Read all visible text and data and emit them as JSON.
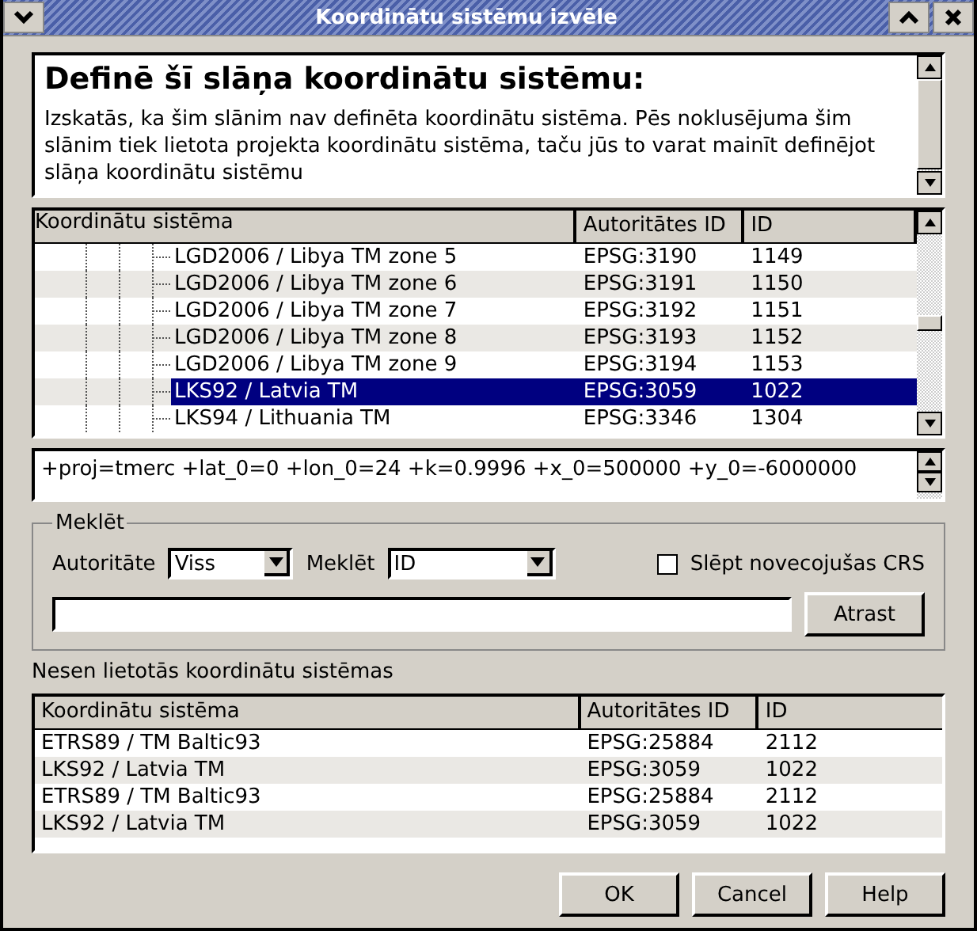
{
  "window": {
    "title": "Koordinātu sistēmu izvēle"
  },
  "description": {
    "heading": "Definē šī slāņa koordinātu sistēmu:",
    "text": "Izskatās, ka šim slānim nav definēta koordinātu sistēma. Pēs noklusējuma šim slānim tiek lietota projekta koordinātu sistēma, taču jūs to varat mainīt definējot slāņa koordinātu sistēmu"
  },
  "crs_tree": {
    "columns": [
      "Koordinātu sistēma",
      "Autoritātes ID",
      "ID"
    ],
    "rows": [
      {
        "name": "LGD2006 / Libya TM zone 5",
        "auth_id": "EPSG:3190",
        "id": "1149",
        "selected": false
      },
      {
        "name": "LGD2006 / Libya TM zone 6",
        "auth_id": "EPSG:3191",
        "id": "1150",
        "selected": false
      },
      {
        "name": "LGD2006 / Libya TM zone 7",
        "auth_id": "EPSG:3192",
        "id": "1151",
        "selected": false
      },
      {
        "name": "LGD2006 / Libya TM zone 8",
        "auth_id": "EPSG:3193",
        "id": "1152",
        "selected": false
      },
      {
        "name": "LGD2006 / Libya TM zone 9",
        "auth_id": "EPSG:3194",
        "id": "1153",
        "selected": false
      },
      {
        "name": "LKS92 / Latvia TM",
        "auth_id": "EPSG:3059",
        "id": "1022",
        "selected": true
      },
      {
        "name": "LKS94 / Lithuania TM",
        "auth_id": "EPSG:3346",
        "id": "1304",
        "selected": false
      }
    ]
  },
  "proj_string": "+proj=tmerc +lat_0=0 +lon_0=24 +k=0.9996 +x_0=500000 +y_0=-6000000",
  "search": {
    "title": "Meklēt",
    "authority_label": "Autoritāte",
    "authority_value": "Viss",
    "search_by_label": "Meklēt",
    "search_by_value": "ID",
    "hide_deprecated": {
      "label": "Slēpt novecojušas CRS",
      "checked": false
    },
    "find_button": "Atrast"
  },
  "recent": {
    "title": "Nesen lietotās koordinātu sistēmas",
    "columns": [
      "Koordinātu sistēma",
      "Autoritātes ID",
      "ID"
    ],
    "rows": [
      {
        "name": "ETRS89 / TM Baltic93",
        "auth_id": "EPSG:25884",
        "id": "2112"
      },
      {
        "name": "LKS92 / Latvia TM",
        "auth_id": "EPSG:3059",
        "id": "1022"
      },
      {
        "name": "ETRS89 / TM Baltic93",
        "auth_id": "EPSG:25884",
        "id": "2112"
      },
      {
        "name": "LKS92 / Latvia TM",
        "auth_id": "EPSG:3059",
        "id": "1022"
      }
    ]
  },
  "buttons": [
    "OK",
    "Cancel",
    "Help"
  ]
}
